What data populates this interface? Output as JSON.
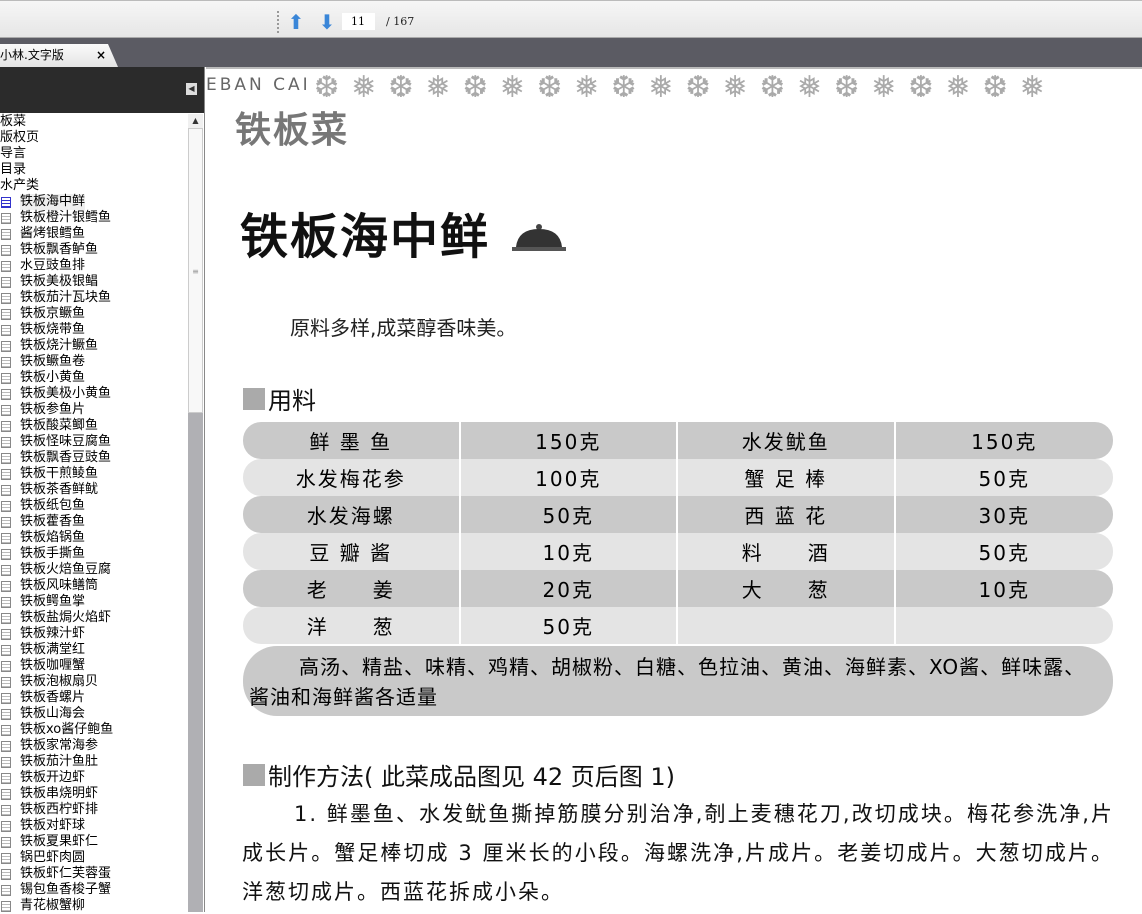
{
  "toolbar": {
    "page_current": "11",
    "page_total": "/ 167",
    "prev_icon": "up-arrow-icon",
    "next_icon": "down-arrow-icon"
  },
  "tab": {
    "label": "小林.文字版",
    "close": "×"
  },
  "sidebar": {
    "items": [
      "板菜",
      "版权页",
      "导言",
      "目录",
      "水产类"
    ],
    "children": [
      "铁板海中鲜",
      "铁板橙汁银鳕鱼",
      "酱烤银鳕鱼",
      "铁板飘香鲈鱼",
      "水豆豉鱼排",
      "铁板美极银鲳",
      "铁板茄汁瓦块鱼",
      "铁板京鳜鱼",
      "铁板烧带鱼",
      "铁板烧汁鳜鱼",
      "铁板鳜鱼卷",
      "铁板小黄鱼",
      "铁板美极小黄鱼",
      "铁板参鱼片",
      "铁板酸菜鲫鱼",
      "铁板怪味豆腐鱼",
      "铁板飘香豆豉鱼",
      "铁板干煎鲮鱼",
      "铁板茶香鲜鱿",
      "铁板纸包鱼",
      "铁板藿香鱼",
      "铁板焰锅鱼",
      "铁板手撕鱼",
      "铁板火焙鱼豆腐",
      "铁板风味鳝筒",
      "铁板鳄鱼掌",
      "铁板盐焗火焰虾",
      "铁板辣汁虾",
      "铁板满堂红",
      "铁板咖喱蟹",
      "铁板泡椒扇贝",
      "铁板香螺片",
      "铁板山海会",
      "铁板xo酱仔鲍鱼",
      "铁板家常海参",
      "铁板茄汁鱼肚",
      "铁板开边虾",
      "铁板串烧明虾",
      "铁板西柠虾排",
      "铁板对虾球",
      "铁板夏果虾仁",
      "锅巴虾肉圆",
      "铁板虾仁芙蓉蛋",
      "锡包鱼香梭子蟹",
      "青花椒蟹柳"
    ]
  },
  "page": {
    "banner": "EBAN CAI",
    "section": "铁板菜",
    "title": "铁板海中鲜",
    "intro": "原料多样,成菜醇香味美。",
    "ingredients_heading": "用料",
    "ingredients": [
      [
        "鲜 墨 鱼",
        "150克",
        "水发鱿鱼",
        "150克"
      ],
      [
        "水发梅花参",
        "100克",
        "蟹 足 棒",
        "50克"
      ],
      [
        "水发海螺",
        "50克",
        "西 蓝 花",
        "30克"
      ],
      [
        "豆 瓣 酱",
        "10克",
        "料　　酒",
        "50克"
      ],
      [
        "老　　姜",
        "20克",
        "大　　葱",
        "10克"
      ],
      [
        "洋　　葱",
        "50克",
        "",
        ""
      ]
    ],
    "seasonings": "高汤、精盐、味精、鸡精、胡椒粉、白糖、色拉油、黄油、海鲜素、XO酱、鲜味露、酱油和海鲜酱各适量",
    "method_heading": "制作方法( 此菜成品图见 42 页后图 1)",
    "method": [
      "1. 鲜墨鱼、水发鱿鱼撕掉筋膜分别治净,剞上麦穗花刀,改切成块。梅花参洗净,片成长片。蟹足棒切成 3 厘米长的小段。海螺洗净,片成片。老姜切成片。大葱切成片。洋葱切成片。西蓝花拆成小朵。"
    ]
  }
}
